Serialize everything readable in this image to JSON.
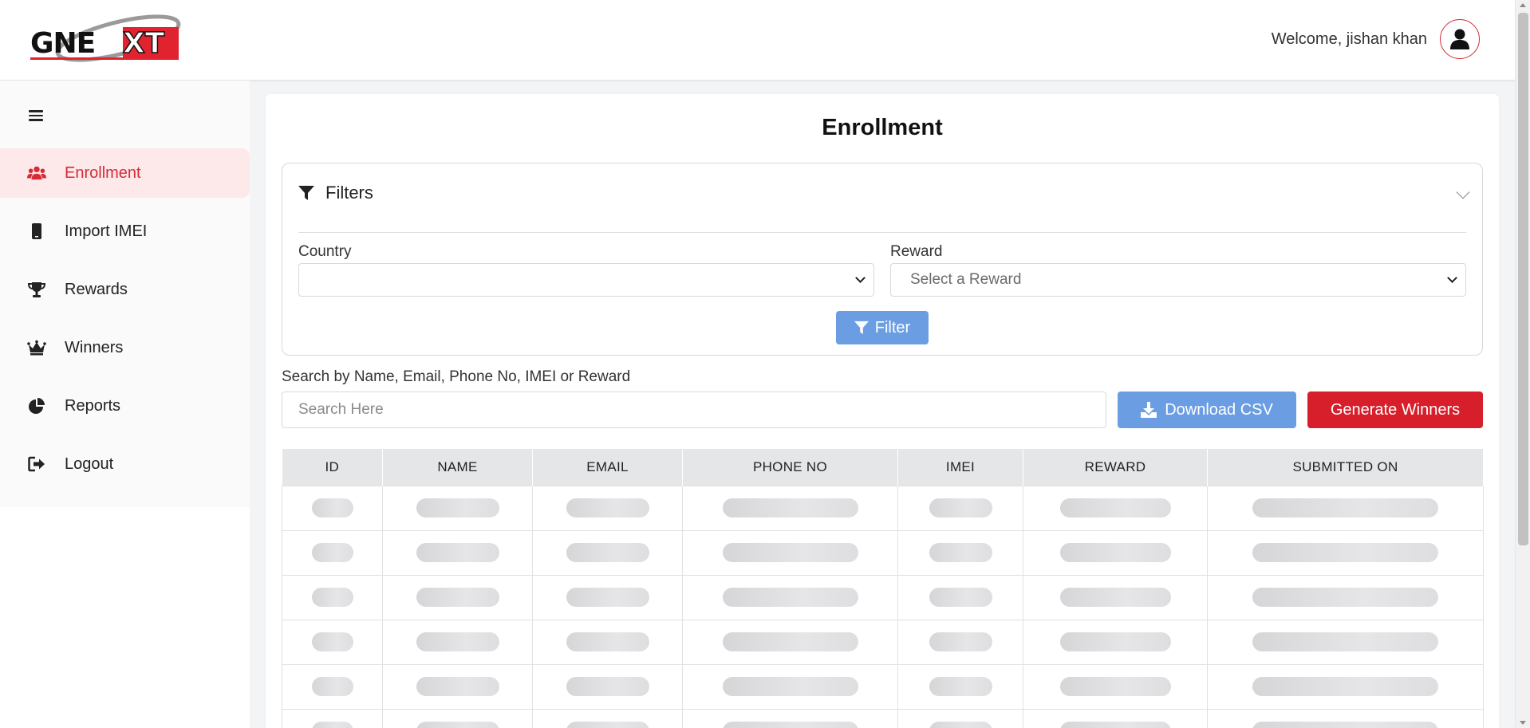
{
  "header": {
    "logo_text": "GNEXT",
    "welcome_text": "Welcome, jishan khan",
    "avatar_icon": "user-icon"
  },
  "sidebar": {
    "menu_icon": "hamburger-icon",
    "items": [
      {
        "label": "Enrollment",
        "icon": "users-icon",
        "active": true
      },
      {
        "label": "Import IMEI",
        "icon": "mobile-icon",
        "active": false
      },
      {
        "label": "Rewards",
        "icon": "trophy-icon",
        "active": false
      },
      {
        "label": "Winners",
        "icon": "crown-icon",
        "active": false
      },
      {
        "label": "Reports",
        "icon": "pie-chart-icon",
        "active": false
      },
      {
        "label": "Logout",
        "icon": "logout-icon",
        "active": false
      }
    ]
  },
  "main": {
    "title": "Enrollment",
    "filters": {
      "title": "Filters",
      "country_label": "Country",
      "country_value": "",
      "reward_label": "Reward",
      "reward_placeholder": "Select a Reward",
      "filter_button": "Filter"
    },
    "search": {
      "label": "Search by Name, Email, Phone No, IMEI or Reward",
      "placeholder": "Search Here"
    },
    "buttons": {
      "download_csv": "Download CSV",
      "generate_winners": "Generate Winners"
    },
    "table": {
      "columns": [
        "ID",
        "NAME",
        "EMAIL",
        "PHONE NO",
        "IMEI",
        "REWARD",
        "SUBMITTED ON"
      ],
      "loading_rows": 6
    }
  },
  "colors": {
    "brand_red": "#d62c35",
    "primary_blue": "#6b9de3",
    "generate_red": "#d71f2b"
  }
}
